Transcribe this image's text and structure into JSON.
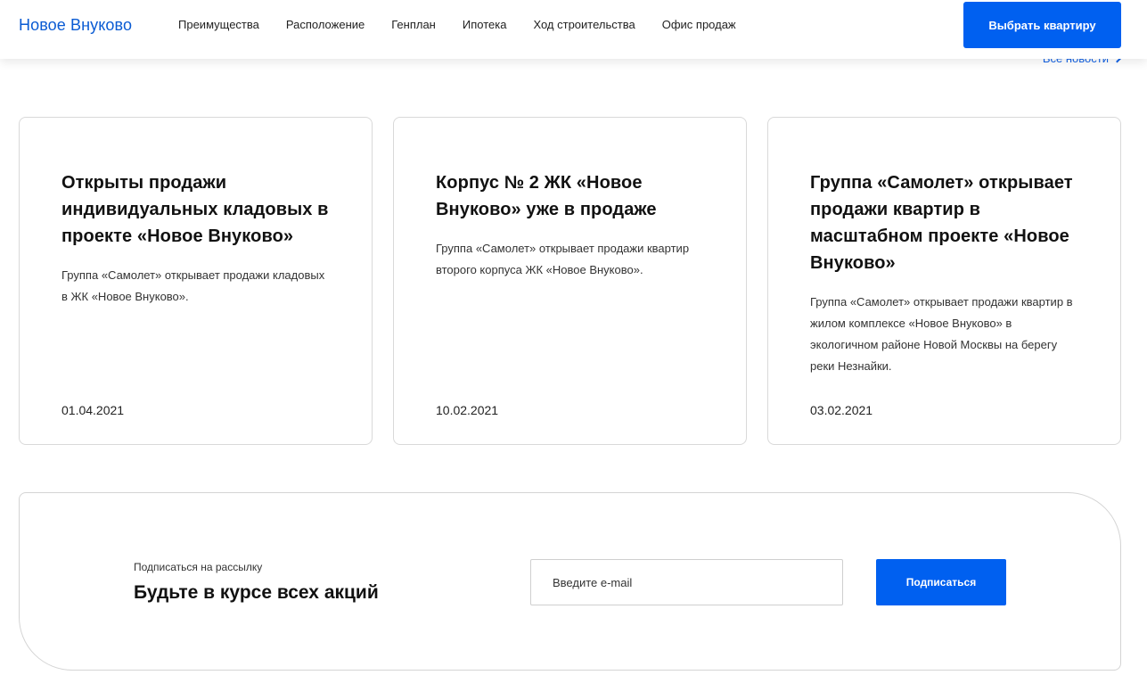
{
  "header": {
    "logo": "Новое Внуково",
    "nav": [
      "Преимущества",
      "Расположение",
      "Генплан",
      "Ипотека",
      "Ход строительства",
      "Офис продаж"
    ],
    "cta_label": "Выбрать квартиру"
  },
  "news": {
    "all_news_label": "Все новости",
    "items": [
      {
        "title": "Открыты продажи индивидуальных кладовых в проекте «Новое Внуково»",
        "text": "Группа «Самолет» открывает продажи кладовых в ЖК «Новое Внуково».",
        "date": "01.04.2021"
      },
      {
        "title": "Корпус № 2 ЖК «Новое Внуково» уже в продаже",
        "text": "Группа «Самолет» открывает продажи квартир второго корпуса ЖК «Новое Внуково».",
        "date": "10.02.2021"
      },
      {
        "title": "Группа «Самолет» открывает продажи квартир в масштабном проекте «Новое Внуково»",
        "text": "Группа «Самолет» открывает продажи квартир в жилом комплексе «Новое Внуково» в экологичном районе Новой Москвы на берегу реки Незнайки.",
        "date": "03.02.2021"
      }
    ]
  },
  "subscribe": {
    "small_label": "Подписаться на рассылку",
    "title": "Будьте в курсе всех акций",
    "email_placeholder": "Введите e-mail",
    "button_label": "Подписаться"
  },
  "colors": {
    "accent": "#0060f0",
    "link": "#1463e6"
  }
}
